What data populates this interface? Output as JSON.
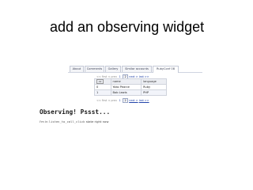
{
  "slide": {
    "title": "add an observing widget"
  },
  "tabs": [
    {
      "label": "About"
    },
    {
      "label": "Comments"
    },
    {
      "label": "Gallery"
    },
    {
      "label": "Similar accounts"
    },
    {
      "label": "RubyConf 08",
      "active": true
    }
  ],
  "pager": {
    "prev": "<< first",
    "prev_page": "< prev",
    "page_1": "1",
    "page_2": "2",
    "next": "next >",
    "last": "last >>"
  },
  "table": {
    "select_label": "All",
    "headers": [
      "id",
      "name",
      "language"
    ],
    "rows": [
      {
        "id": "0",
        "name": "Yoko Pearce",
        "language": "Ruby"
      },
      {
        "id": "1",
        "name": "Bob Lewis",
        "language": "PHP"
      }
    ]
  },
  "observer": {
    "heading": "Observing! Pssst...",
    "sub_prefix": "I'm in",
    "sub_code": "listen_to_call_click",
    "sub_suffix": "state right now"
  }
}
